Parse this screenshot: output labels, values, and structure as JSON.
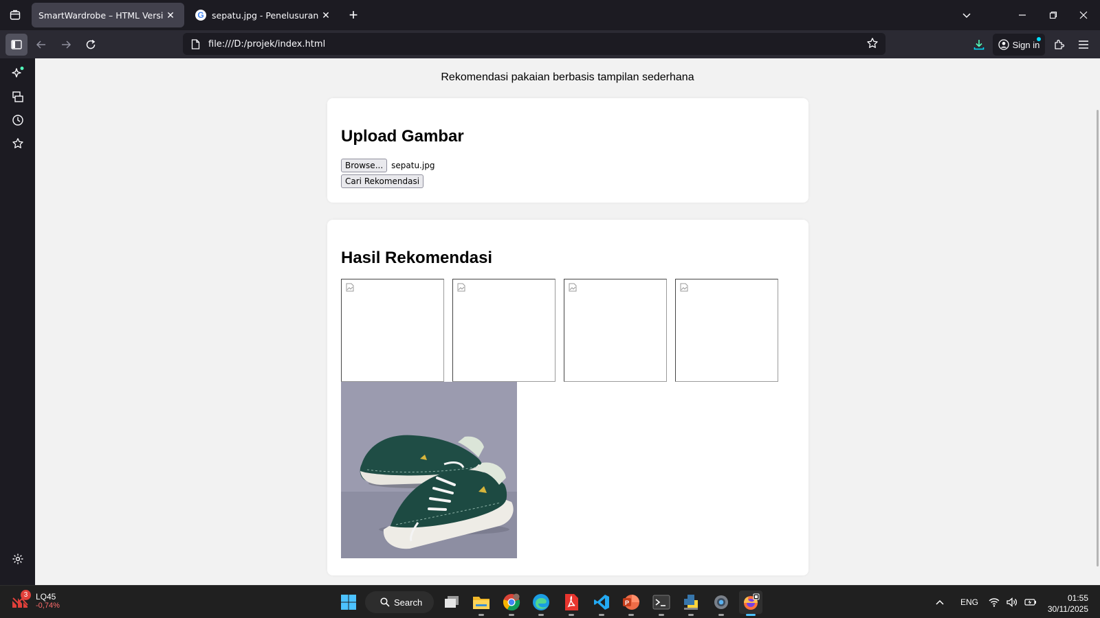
{
  "browser": {
    "tabs": [
      {
        "title": "SmartWardrobe – HTML Version",
        "active": true
      },
      {
        "title": "sepatu.jpg - Penelusuran Google",
        "active": false
      }
    ],
    "url": "file:///D:/projek/index.html",
    "signin_label": "Sign in"
  },
  "page": {
    "subtitle": "Rekomendasi pakaian berbasis tampilan sederhana",
    "upload": {
      "heading": "Upload Gambar",
      "browse_label": "Browse...",
      "filename": "sepatu.jpg",
      "submit_label": "Cari Rekomendasi"
    },
    "results": {
      "heading": "Hasil Rekomendasi",
      "broken_images": 4,
      "photo_icon": "green-sneaker-photo"
    }
  },
  "taskbar": {
    "ticker": {
      "name": "LQ45",
      "change": "-0,74%",
      "badge": "3"
    },
    "search_label": "Search",
    "lang": "ENG",
    "time": "01:55",
    "date": "30/11/2025"
  },
  "colors": {
    "tabstrip": "#1c1b22",
    "navbar": "#2b2a33",
    "page_bg": "#f2f2f2",
    "card_bg": "#ffffff",
    "taskbar": "#202020"
  }
}
